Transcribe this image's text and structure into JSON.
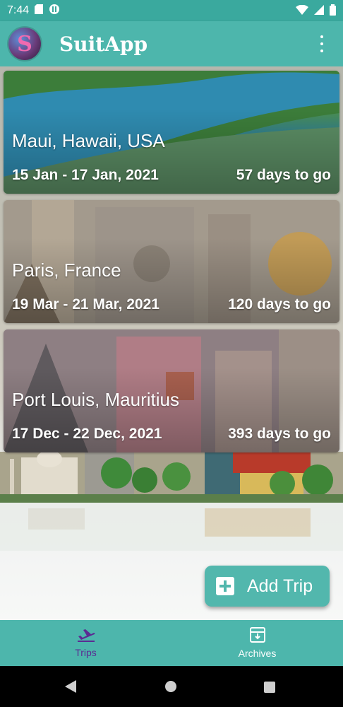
{
  "status_bar": {
    "time": "7:44"
  },
  "app_bar": {
    "title": "SuitApp",
    "logo_letter": "S"
  },
  "trips": [
    {
      "destination": "Maui, Hawaii, USA",
      "dates": "15 Jan - 17 Jan, 2021",
      "countdown": "57 days to go"
    },
    {
      "destination": "Paris, France",
      "dates": "19 Mar - 21 Mar, 2021",
      "countdown": "120 days to go"
    },
    {
      "destination": "Port Louis, Mauritius",
      "dates": "17 Dec - 22 Dec, 2021",
      "countdown": "393 days to go"
    }
  ],
  "fab": {
    "label": "Add Trip",
    "icon": "add-box-icon"
  },
  "bottom_nav": {
    "items": [
      {
        "label": "Trips",
        "icon": "airplane-takeoff-icon",
        "active": true
      },
      {
        "label": "Archives",
        "icon": "archive-icon",
        "active": false
      }
    ]
  },
  "colors": {
    "primary": "#4db6ac",
    "status_bar": "#3aa99e",
    "active_nav": "#5b2b93",
    "text_on_primary": "#ffffff"
  }
}
